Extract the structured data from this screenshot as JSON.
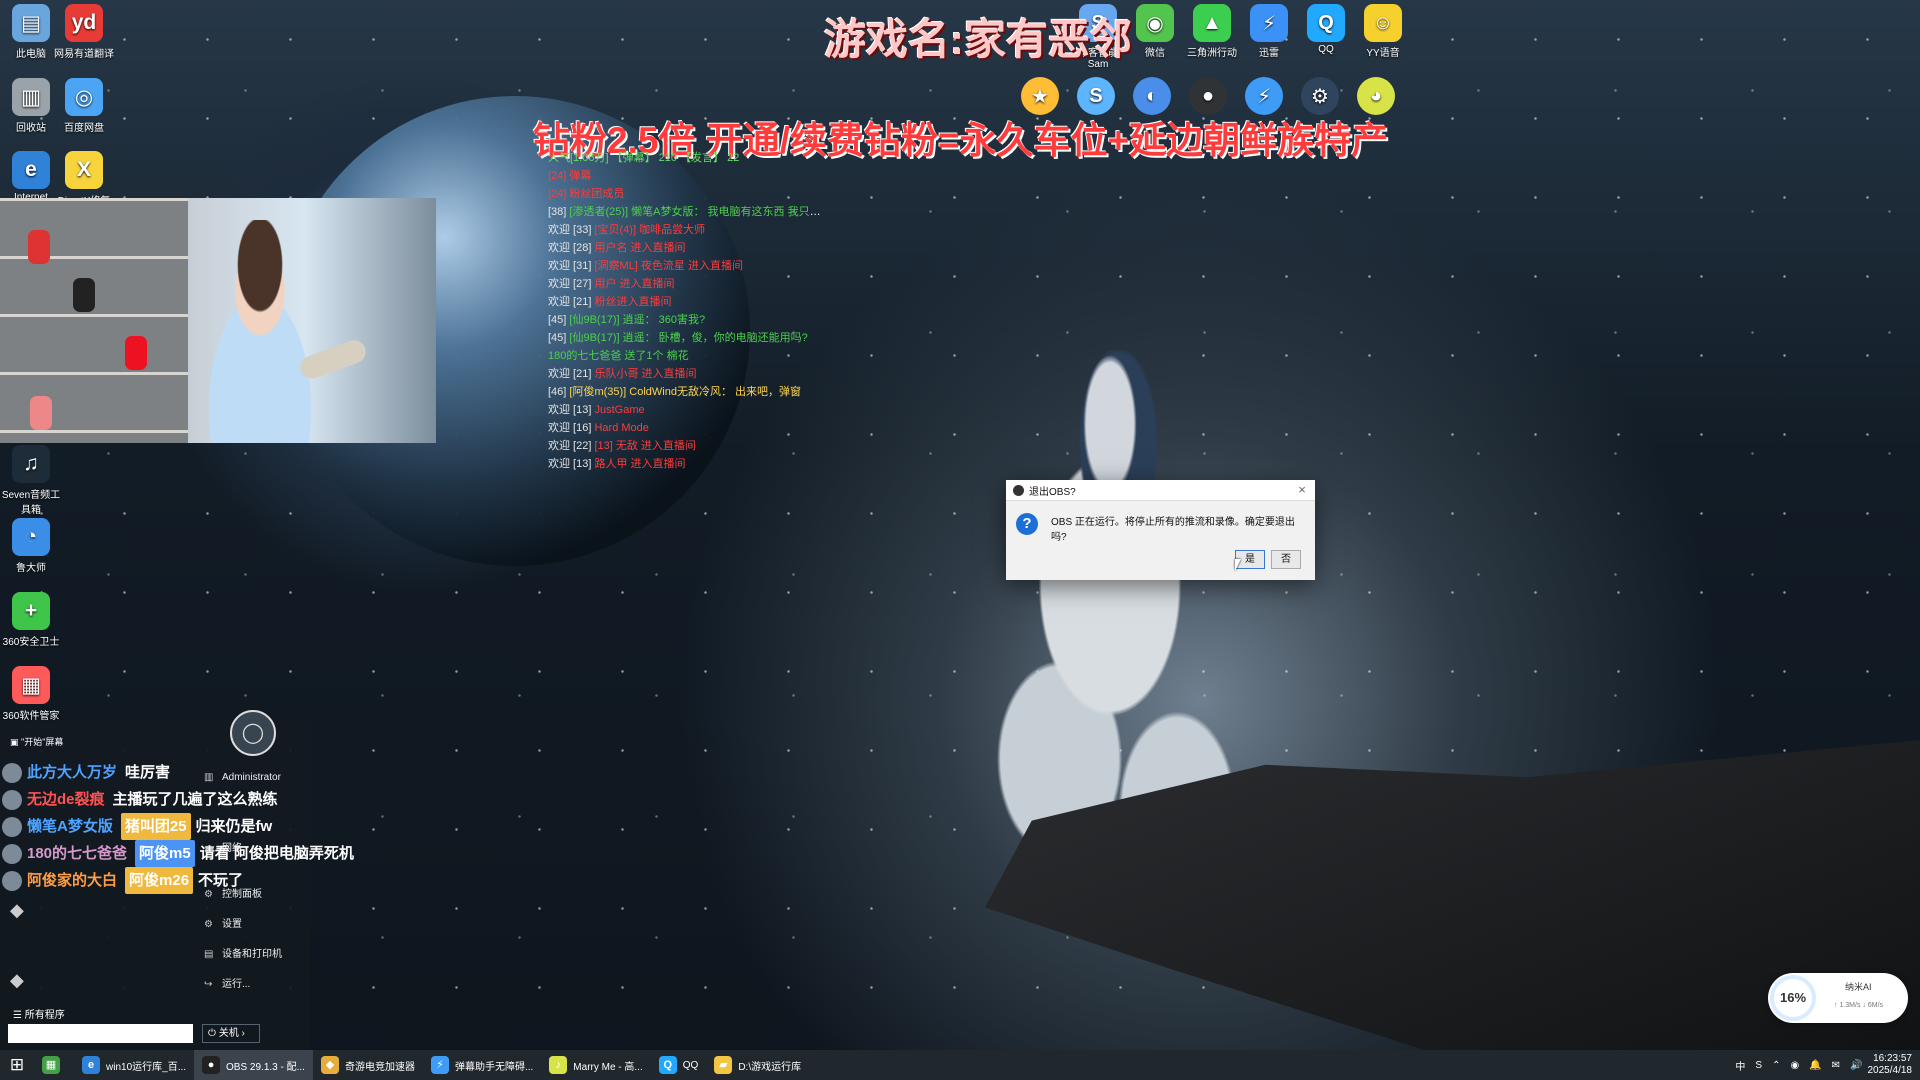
{
  "desktop": {
    "icons": [
      {
        "label": "此电脑",
        "icon": "computer-icon",
        "color": "#6aa6de",
        "glyph": "▤"
      },
      {
        "label": "网易有道翻译",
        "icon": "youdao-icon",
        "color": "#e93b36",
        "glyph": "yd"
      },
      {
        "label": "回收站",
        "icon": "recycle-bin-icon",
        "color": "#9aa3aa",
        "glyph": "▥"
      },
      {
        "label": "百度网盘",
        "icon": "baidu-netdisk-icon",
        "color": "#4ca4f4",
        "glyph": "◎"
      },
      {
        "label": "Internet",
        "icon": "ie-icon",
        "color": "#2f82d8",
        "glyph": "e"
      },
      {
        "label": "DirectX修复",
        "icon": "directx-icon",
        "color": "#f7d43b",
        "glyph": "X"
      },
      {
        "label": "Seven音频工具箱",
        "icon": "audio-tool-icon",
        "color": "#1e2b38",
        "glyph": "♫"
      },
      {
        "label": "鲁大师",
        "icon": "ludashi-icon",
        "color": "#3b8ee8",
        "glyph": "◔"
      },
      {
        "label": "360安全卫士",
        "icon": "security-360-icon",
        "color": "#3fc54a",
        "glyph": "+"
      },
      {
        "label": "360软件管家",
        "icon": "software-manager-icon",
        "color": "#ff5a5a",
        "glyph": "▦"
      }
    ],
    "top_icons_row1": [
      {
        "label": "极客智能Sam",
        "icon": "pin-icon",
        "color": "#67a7f0",
        "glyph": "S"
      },
      {
        "label": "微信",
        "icon": "wechat-icon",
        "color": "#53c44d",
        "glyph": "◉"
      },
      {
        "label": "三角洲行动",
        "icon": "delta-force-icon",
        "color": "#3ccf4f",
        "glyph": "▲"
      },
      {
        "label": "迅雷",
        "icon": "thunder-icon",
        "color": "#3b91f5",
        "glyph": "⚡"
      },
      {
        "label": "QQ",
        "icon": "qq-icon",
        "color": "#20a9ff",
        "glyph": "Q"
      },
      {
        "label": "YY语音",
        "icon": "yy-icon",
        "color": "#f6d02c",
        "glyph": "☺"
      }
    ],
    "top_icons_row2": [
      {
        "label": "",
        "icon": "vip-icon",
        "color": "#ffbc35",
        "glyph": "★"
      },
      {
        "label": "",
        "icon": "s-app-icon",
        "color": "#5db5ff",
        "glyph": "S"
      },
      {
        "label": "",
        "icon": "browser-icon",
        "color": "#4a8eea",
        "glyph": "◐"
      },
      {
        "label": "",
        "icon": "obs-icon",
        "color": "#303336",
        "glyph": "●"
      },
      {
        "label": "",
        "icon": "thunder-blue-icon",
        "color": "#3e9cf7",
        "glyph": "⚡"
      },
      {
        "label": "",
        "icon": "steam-icon",
        "color": "#2f455e",
        "glyph": "⚙"
      },
      {
        "label": "",
        "icon": "green-app-icon",
        "color": "#d8e347",
        "glyph": "◕"
      }
    ]
  },
  "overlay": {
    "game_title": "游戏名:家有恶邻",
    "promo": "钻粉2.5倍 开通/续费钻粉=永久车位+延边朝鲜族特产",
    "danmu_header": "人气[1.06万] 【弹幕】 210 【发言】 22"
  },
  "danmu": [
    {
      "prefix": "",
      "name": "[24] 弹幕",
      "text": "",
      "cls": "name-red"
    },
    {
      "prefix": "",
      "name": "[24] 粉丝团成员",
      "text": "",
      "cls": "name-red"
    },
    {
      "prefix": "[38]",
      "name": "[渗透者(25)] 懒笔A梦女版：",
      "text": "我电脑有这东西 我只能跑打了",
      "cls": "name-green"
    },
    {
      "prefix": "欢迎 [33]",
      "name": "[宝贝(4)] 咖啡品尝大师",
      "text": "",
      "cls": "name-red"
    },
    {
      "prefix": "欢迎 [28]",
      "name": "用户名 进入直播间",
      "text": "",
      "cls": "name-red"
    },
    {
      "prefix": "欢迎 [31]",
      "name": "[洞察ML] 夜色流星 进入直播间",
      "text": "",
      "cls": "name-red"
    },
    {
      "prefix": "欢迎 [27]",
      "name": "用户 进入直播间",
      "text": "",
      "cls": "name-red"
    },
    {
      "prefix": "欢迎 [21]",
      "name": "粉丝进入直播间",
      "text": "",
      "cls": "name-red"
    },
    {
      "prefix": "[45]",
      "name": "[仙9B(17)] 逍遥：",
      "text": "360害我?",
      "cls": "name-green"
    },
    {
      "prefix": "[45]",
      "name": "[仙9B(17)] 逍遥：",
      "text": "卧槽，俊，你的电脑还能用吗?",
      "cls": "name-green"
    },
    {
      "prefix": "",
      "name": "180的七七爸爸",
      "text": "送了1个 棉花",
      "cls": "name-green"
    },
    {
      "prefix": "欢迎 [21]",
      "name": "乐队小哥 进入直播间",
      "text": "",
      "cls": "name-red"
    },
    {
      "prefix": "[46]",
      "name": "[阿俊m(35)] ColdWind无敌冷风：",
      "text": "出来吧，弹窗",
      "cls": "name-yellow"
    },
    {
      "prefix": "欢迎 [13]",
      "name": "JustGame",
      "text": "",
      "cls": "name-red"
    },
    {
      "prefix": "欢迎 [16]",
      "name": "Hard Mode",
      "text": "",
      "cls": "name-red"
    },
    {
      "prefix": "欢迎 [22]",
      "name": "[13] 无敌 进入直播间",
      "text": "",
      "cls": "name-red"
    },
    {
      "prefix": "欢迎 [13]",
      "name": "路人甲 进入直播间",
      "text": "",
      "cls": "name-red"
    }
  ],
  "dialog": {
    "title": "退出OBS?",
    "message": "OBS 正在运行。将停止所有的推流和录像。确定要退出吗?",
    "yes": "是",
    "no": "否"
  },
  "startmenu": {
    "header": "\"开始\"屏幕",
    "user": "Administrator",
    "items": [
      "控制面板",
      "设置",
      "设备和打印机",
      "运行..."
    ],
    "partial": "网络",
    "all_programs": "所有程序",
    "search_placeholder": "",
    "shutdown": "关机"
  },
  "chat": [
    {
      "name": "此方大人万岁",
      "badge": "",
      "text": "哇厉害",
      "color": "blue",
      "badge_cls": ""
    },
    {
      "name": "无边de裂痕",
      "badge": "",
      "text": "主播玩了几遍了这么熟练",
      "color": "red",
      "badge_cls": ""
    },
    {
      "name": "懒笔A梦女版",
      "badge": "猪叫团25",
      "text": "归来仍是fw",
      "color": "blue",
      "badge_cls": ""
    },
    {
      "name": "180的七七爸爸",
      "badge": "阿俊m5",
      "text": "请看 阿俊把电脑弄死机",
      "color": "pink",
      "badge_cls": "blue"
    },
    {
      "name": "阿俊家的大白",
      "badge": "阿俊m26",
      "text": "不玩了",
      "color": "orange",
      "badge_cls": ""
    }
  ],
  "widget": {
    "percent": "16%",
    "brand": "纳米AI",
    "speed": "↑ 1.3M/s  ↓ 6M/s"
  },
  "taskbar": {
    "buttons": [
      {
        "label": "",
        "icon": "start-icon",
        "glyph": "⊞",
        "color": "#20272d"
      },
      {
        "label": "",
        "icon": "store-icon",
        "glyph": "▦",
        "color": "#43a047"
      },
      {
        "label": "win10运行库_百...",
        "icon": "edge-icon",
        "glyph": "e",
        "color": "#2f82d8"
      },
      {
        "label": "OBS 29.1.3 - 配...",
        "icon": "obs-taskbar-icon",
        "glyph": "●",
        "color": "#222"
      },
      {
        "label": "奇游电竞加速器",
        "icon": "accelerator-icon",
        "glyph": "◆",
        "color": "#e6ad3c"
      },
      {
        "label": "弹幕助手无障碍...",
        "icon": "danmu-icon",
        "glyph": "⚡",
        "color": "#3e9cf7"
      },
      {
        "label": "Marry Me - 高...",
        "icon": "music-icon",
        "glyph": "♪",
        "color": "#d8e347"
      },
      {
        "label": "QQ",
        "icon": "qq-taskbar-icon",
        "glyph": "Q",
        "color": "#20a9ff"
      },
      {
        "label": "D:\\游戏运行库",
        "icon": "folder-icon",
        "glyph": "▰",
        "color": "#f4c542"
      }
    ],
    "tray": [
      "中",
      "S",
      "⌃",
      "◉",
      "🔔",
      "✉",
      "🔊"
    ],
    "time": "16:23:57",
    "date": "2025/4/18"
  }
}
